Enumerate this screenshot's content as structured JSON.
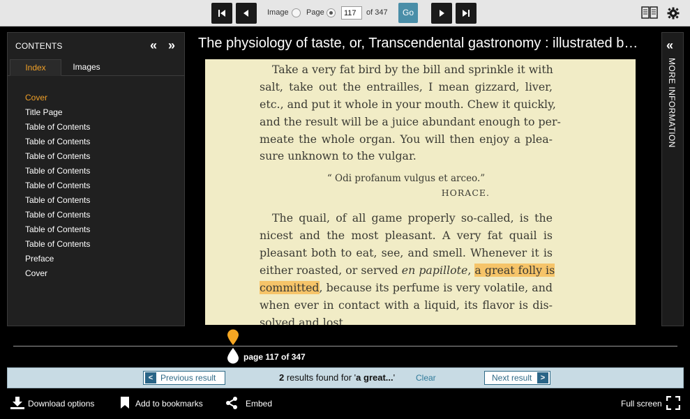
{
  "toolbar": {
    "image_label": "Image",
    "page_label": "Page",
    "page_value": "117",
    "of_label": "of 347",
    "go_label": "Go",
    "view_mode": "page",
    "accent": "#4a8ea8"
  },
  "contents": {
    "title": "CONTENTS",
    "tabs": [
      {
        "label": "Index",
        "active": true
      },
      {
        "label": "Images",
        "active": false
      }
    ],
    "items": [
      {
        "label": "Cover",
        "current": true
      },
      {
        "label": "Title Page"
      },
      {
        "label": "Table of Contents"
      },
      {
        "label": "Table of Contents"
      },
      {
        "label": "Table of Contents"
      },
      {
        "label": "Table of Contents"
      },
      {
        "label": "Table of Contents"
      },
      {
        "label": "Table of Contents"
      },
      {
        "label": "Table of Contents"
      },
      {
        "label": "Table of Contents"
      },
      {
        "label": "Table of Contents"
      },
      {
        "label": "Preface"
      },
      {
        "label": "Cover"
      }
    ]
  },
  "viewer": {
    "title": "The physiology of taste, or, Transcendental gastronomy : illustrated by…",
    "page_lines": [
      "Take a very fat bird by the bill and sprinkle it with",
      "salt, take out the entrailles, I mean gizzard, liver,",
      "etc., and put it whole in your mouth. Chew it quickly,",
      "and the result will be a juice abundant enough to per-",
      "meate the whole organ. You will then enjoy a plea-",
      "sure unknown to the vulgar."
    ],
    "quote": "“ Odi profanum vulgus et arceo.”",
    "attribution": "HORACE.",
    "page_lines_2": {
      "l1": "The quail, of all game properly so-called, is the",
      "l2": "nicest and the most pleasant. A very fat quail is",
      "l3": "pleasant both to eat, see, and smell. Whenever it is",
      "l4_pre": "either roasted, or served ",
      "l4_italic": "en papillote",
      "l4_mid": ", ",
      "l4_hl": "a great folly is",
      "l5_hl": "committed",
      "l5_post": ", because its perfume is very volatile, and",
      "l6": "when ever in contact with a liquid, its flavor is dis-",
      "l7": "solved and lost."
    },
    "highlight_color": "#f6c469"
  },
  "more_info": {
    "label": "MORE INFORMATION"
  },
  "slider": {
    "page_label": "page 117 of 347",
    "marker_color": "#f5a623"
  },
  "search": {
    "prev_label": "Previous result",
    "next_label": "Next result",
    "count": "2",
    "found_text": " results found for '",
    "query": "a great...",
    "close_quote": "'",
    "clear_label": "Clear"
  },
  "bottom": {
    "download_label": "Download options",
    "bookmark_label": "Add to bookmarks",
    "embed_label": "Embed",
    "fullscreen_label": "Full screen"
  }
}
